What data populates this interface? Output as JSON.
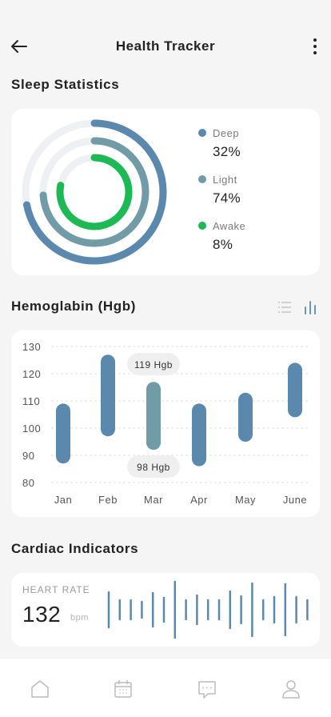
{
  "header": {
    "title": "Health Tracker",
    "back_icon": "arrow-left-icon",
    "more_icon": "more-vertical-icon"
  },
  "sleep": {
    "title": "Sleep Statistics",
    "items": [
      {
        "name": "Deep",
        "value": "32%",
        "color": "#5b88ad"
      },
      {
        "name": "Light",
        "value": "74%",
        "color": "#729ba8"
      },
      {
        "name": "Awake",
        "value": "8%",
        "color": "#1db954"
      }
    ]
  },
  "hemoglobin": {
    "title": "Hemoglabin (Hgb)",
    "view_icons": [
      "list-icon",
      "bar-chart-icon"
    ],
    "active_color": "#6a98b8",
    "chart_data": {
      "type": "bar",
      "categories": [
        "Jan",
        "Feb",
        "Mar",
        "Apr",
        "May",
        "June"
      ],
      "series": [
        {
          "ranges": [
            [
              87,
              109
            ],
            [
              97,
              127
            ],
            [
              92,
              117
            ],
            [
              86,
              109
            ],
            [
              95,
              113
            ],
            [
              104,
              124
            ]
          ]
        }
      ],
      "ylim": [
        80,
        130
      ],
      "yticks": [
        130,
        120,
        110,
        100,
        90,
        80
      ],
      "grid": true,
      "annotations": [
        {
          "category": "Mar",
          "label": "119 Hgb",
          "position": "top"
        },
        {
          "category": "Mar",
          "label": "98 Hgb",
          "position": "bottom"
        }
      ],
      "colors": {
        "default": "#5b88ad",
        "highlight": "#729ba8"
      }
    }
  },
  "cardiac": {
    "title": "Cardiac Indicators",
    "heart_rate_label": "HEART RATE",
    "heart_rate_value": "132",
    "heart_rate_unit": "bpm",
    "wave_color": "#5b88ad"
  },
  "nav": {
    "items": [
      "home-icon",
      "calendar-icon",
      "chat-icon",
      "profile-icon"
    ]
  }
}
